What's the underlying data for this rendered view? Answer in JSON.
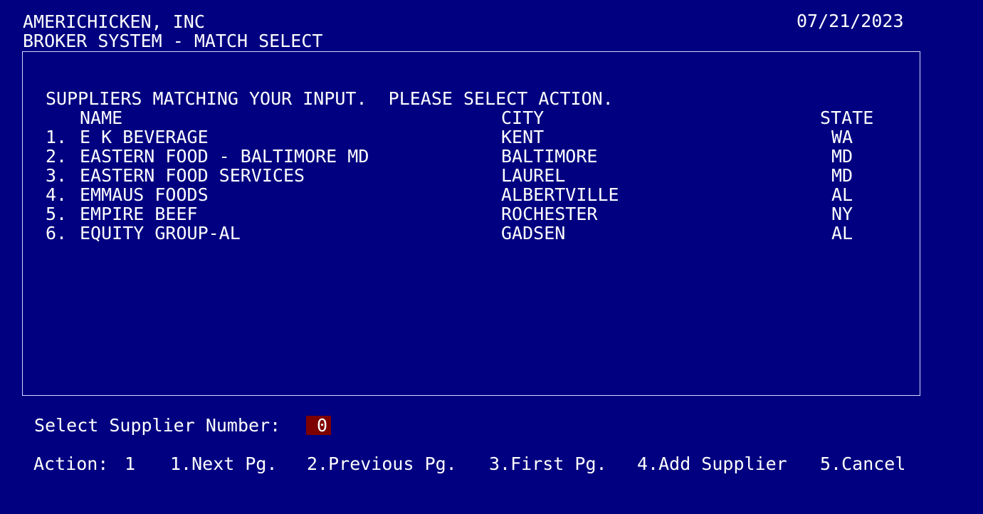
{
  "header": {
    "company": "AMERICHICKEN, INC",
    "system": "BROKER SYSTEM - MATCH SELECT",
    "date": "07/21/2023"
  },
  "panel": {
    "message": "SUPPLIERS MATCHING YOUR INPUT.  PLEASE SELECT ACTION.",
    "columns": {
      "name": "NAME",
      "city": "CITY",
      "state": "STATE"
    },
    "rows": [
      {
        "num": "1.",
        "name": "E K BEVERAGE",
        "city": "KENT",
        "state": "WA"
      },
      {
        "num": "2.",
        "name": "EASTERN FOOD - BALTIMORE MD",
        "city": "BALTIMORE",
        "state": "MD"
      },
      {
        "num": "3.",
        "name": "EASTERN FOOD SERVICES",
        "city": "LAUREL",
        "state": "MD"
      },
      {
        "num": "4.",
        "name": "EMMAUS FOODS",
        "city": "ALBERTVILLE",
        "state": "AL"
      },
      {
        "num": "5.",
        "name": "EMPIRE BEEF",
        "city": "ROCHESTER",
        "state": "NY"
      },
      {
        "num": "6.",
        "name": "EQUITY GROUP-AL",
        "city": "GADSEN",
        "state": "AL"
      }
    ]
  },
  "select": {
    "label": "Select Supplier Number:",
    "value": "0"
  },
  "action": {
    "label": "Action:",
    "value": "1",
    "options": [
      "1.Next Pg.",
      "2.Previous Pg.",
      "3.First Pg.",
      "4.Add Supplier",
      "5.Cancel"
    ]
  },
  "colors": {
    "background": "#000080",
    "text": "#ffffff",
    "input_highlight": "#7d0000"
  }
}
